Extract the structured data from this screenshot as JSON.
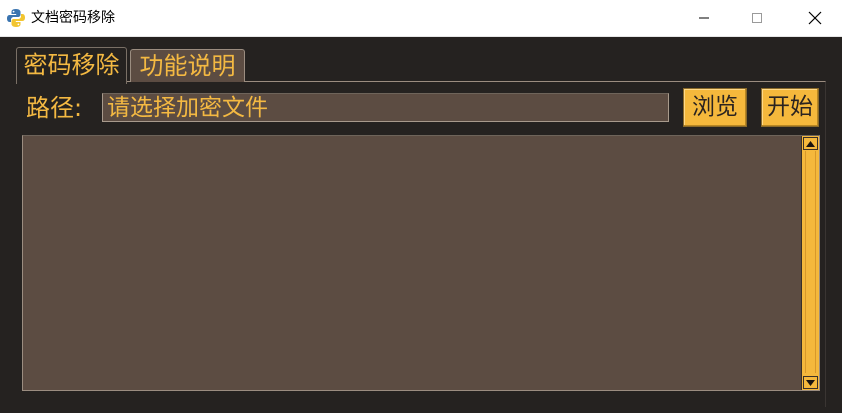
{
  "window": {
    "title": "文档密码移除"
  },
  "tabs": [
    {
      "label": "密码移除",
      "active": true
    },
    {
      "label": "功能说明",
      "active": false
    }
  ],
  "path": {
    "label": "路径:",
    "placeholder": "请选择加密文件",
    "value": ""
  },
  "buttons": {
    "browse": "浏览",
    "start": "开始"
  },
  "output": {
    "text": ""
  },
  "colors": {
    "background": "#252220",
    "field": "#5c4c42",
    "accent": "#f4b942",
    "button": "#f5b83c"
  }
}
